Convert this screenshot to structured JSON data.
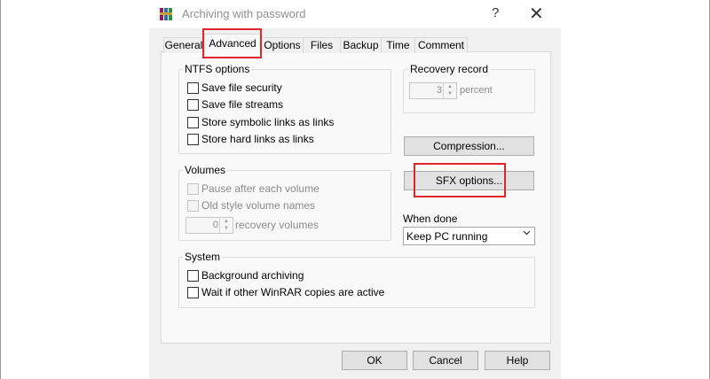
{
  "window": {
    "title": "Archiving with password",
    "help_glyph": "?",
    "close_glyph": "✕"
  },
  "tabs": [
    {
      "label": "General"
    },
    {
      "label": "Advanced",
      "active": true
    },
    {
      "label": "Options"
    },
    {
      "label": "Files"
    },
    {
      "label": "Backup"
    },
    {
      "label": "Time"
    },
    {
      "label": "Comment"
    }
  ],
  "ntfs": {
    "title": "NTFS options",
    "items": [
      {
        "label": "Save file security",
        "checked": false
      },
      {
        "label": "Save file streams",
        "checked": false
      },
      {
        "label": "Store symbolic links as links",
        "checked": false
      },
      {
        "label": "Store hard links as links",
        "checked": false
      }
    ]
  },
  "recovery": {
    "title": "Recovery record",
    "value": "3",
    "unit": "percent"
  },
  "volumes": {
    "title": "Volumes",
    "items": [
      {
        "label": "Pause after each volume",
        "checked": false
      },
      {
        "label": "Old style volume names",
        "checked": false
      }
    ],
    "recovery_value": "0",
    "recovery_label": "recovery volumes"
  },
  "side_buttons": {
    "compression": "Compression...",
    "sfx": "SFX options..."
  },
  "when_done": {
    "label": "When done",
    "selected": "Keep PC running"
  },
  "system": {
    "title": "System",
    "items": [
      {
        "label": "Background archiving",
        "checked": false
      },
      {
        "label": "Wait if other WinRAR copies are active",
        "checked": false
      }
    ]
  },
  "footer": {
    "ok": "OK",
    "cancel": "Cancel",
    "help": "Help"
  },
  "colors": {
    "highlight": "#e0262b",
    "dialog_bg": "#f0f0f0",
    "panel_bg": "#f9f9f9"
  }
}
